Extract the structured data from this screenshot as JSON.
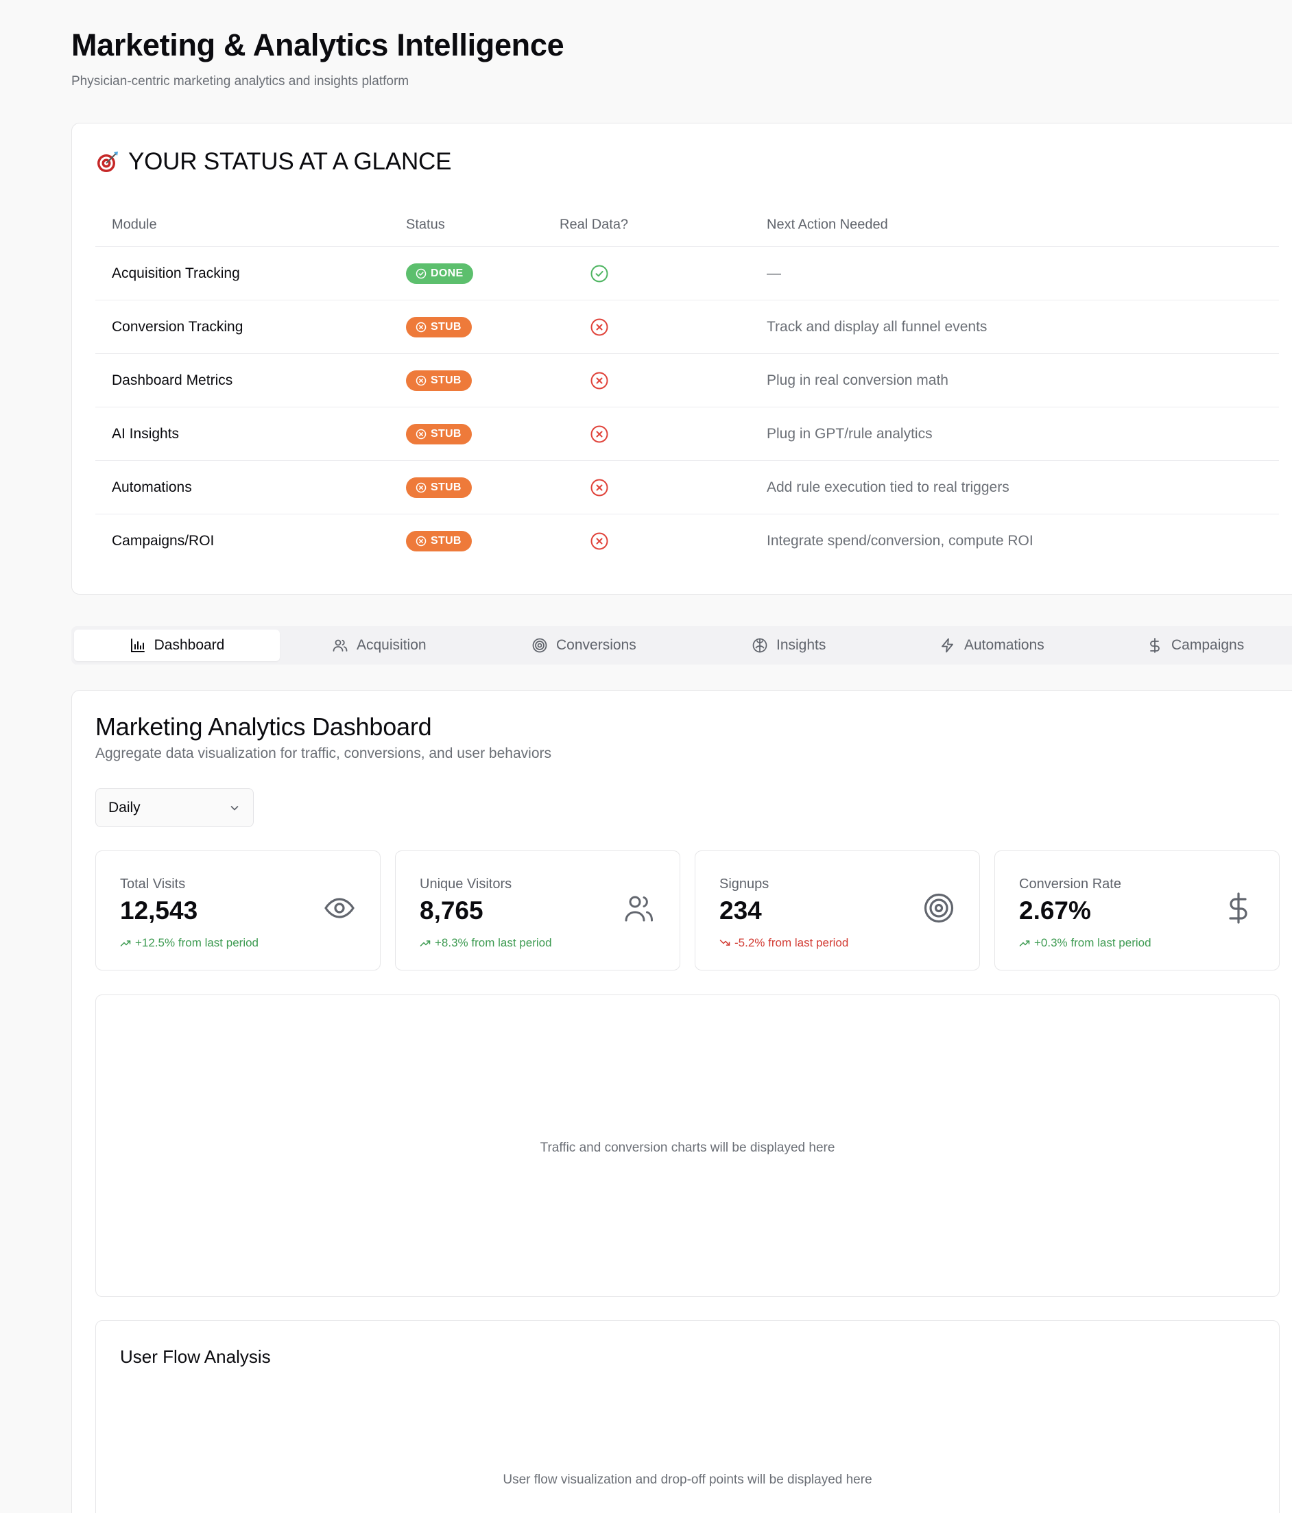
{
  "header": {
    "title": "Marketing & Analytics Intelligence",
    "subtitle": "Physician-centric marketing analytics and insights platform"
  },
  "status_glance": {
    "heading": "YOUR STATUS AT A GLANCE",
    "heading_icon": "direct-hit-target-icon",
    "columns": [
      "Module",
      "Status",
      "Real Data?",
      "Next Action Needed"
    ],
    "rows": [
      {
        "module": "Acquisition Tracking",
        "status": "DONE",
        "real_data": "check-icon",
        "next_action": "—"
      },
      {
        "module": "Conversion Tracking",
        "status": "STUB",
        "real_data": "x-icon",
        "next_action": "Track and display all funnel events"
      },
      {
        "module": "Dashboard Metrics",
        "status": "STUB",
        "real_data": "x-icon",
        "next_action": "Plug in real conversion math"
      },
      {
        "module": "AI Insights",
        "status": "STUB",
        "real_data": "x-icon",
        "next_action": "Plug in GPT/rule analytics"
      },
      {
        "module": "Automations",
        "status": "STUB",
        "real_data": "x-icon",
        "next_action": "Add rule execution tied to real triggers"
      },
      {
        "module": "Campaigns/ROI",
        "status": "STUB",
        "real_data": "x-icon",
        "next_action": "Integrate spend/conversion, compute ROI"
      }
    ]
  },
  "tabs": [
    {
      "label": "Dashboard",
      "icon": "bar-chart-icon",
      "active": true
    },
    {
      "label": "Acquisition",
      "icon": "users-icon",
      "active": false
    },
    {
      "label": "Conversions",
      "icon": "target-icon",
      "active": false
    },
    {
      "label": "Insights",
      "icon": "brain-icon",
      "active": false
    },
    {
      "label": "Automations",
      "icon": "zap-icon",
      "active": false
    },
    {
      "label": "Campaigns",
      "icon": "dollar-icon",
      "active": false
    }
  ],
  "dashboard": {
    "title": "Marketing Analytics Dashboard",
    "subtitle": "Aggregate data visualization for traffic, conversions, and user behaviors",
    "period_select": {
      "value": "Daily"
    },
    "metrics": [
      {
        "label": "Total Visits",
        "value": "12,543",
        "change": "+12.5% from last period",
        "trend": "up",
        "icon": "eye-icon"
      },
      {
        "label": "Unique Visitors",
        "value": "8,765",
        "change": "+8.3% from last period",
        "trend": "up",
        "icon": "users-icon"
      },
      {
        "label": "Signups",
        "value": "234",
        "change": "-5.2% from last period",
        "trend": "down",
        "icon": "target-icon"
      },
      {
        "label": "Conversion Rate",
        "value": "2.67%",
        "change": "+0.3% from last period",
        "trend": "up",
        "icon": "dollar-icon"
      }
    ],
    "chart_placeholder": "Traffic and conversion charts will be displayed here",
    "user_flow": {
      "title": "User Flow Analysis",
      "placeholder": "User flow visualization and drop-off points will be displayed here"
    }
  },
  "colors": {
    "done_badge": "#5cbf6d",
    "stub_badge": "#ee7a3a",
    "trend_up": "#3e9b52",
    "trend_down": "#d23b33"
  }
}
